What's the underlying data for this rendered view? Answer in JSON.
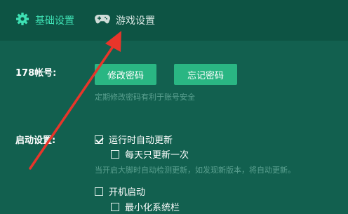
{
  "tabs": [
    {
      "label": "基础设置",
      "icon": "gear-icon",
      "active": true
    },
    {
      "label": "游戏设置",
      "icon": "gamepad-icon",
      "active": false
    }
  ],
  "account": {
    "label": "178帐号:",
    "change_password": "修改密码",
    "forgot_password": "忘记密码",
    "hint": "定期修改密码有利于账号安全"
  },
  "startup": {
    "label": "启动设置:",
    "auto_update": {
      "label": "运行时自动更新",
      "checked": true
    },
    "update_once_daily": {
      "label": "每天只更新一次",
      "checked": false
    },
    "hint": "当开启大脚时自动检测更新，如发现新版本，将自动更新。",
    "launch_on_boot": {
      "label": "开机启动",
      "checked": false
    },
    "minimize_to_tray": {
      "label": "最小化系统栏",
      "checked": false
    }
  },
  "colors": {
    "background": "#12604f",
    "topbar": "#0d5444",
    "accent": "#3ee0b3",
    "button": "#2ab683",
    "annotation_arrow": "#e8352a"
  }
}
